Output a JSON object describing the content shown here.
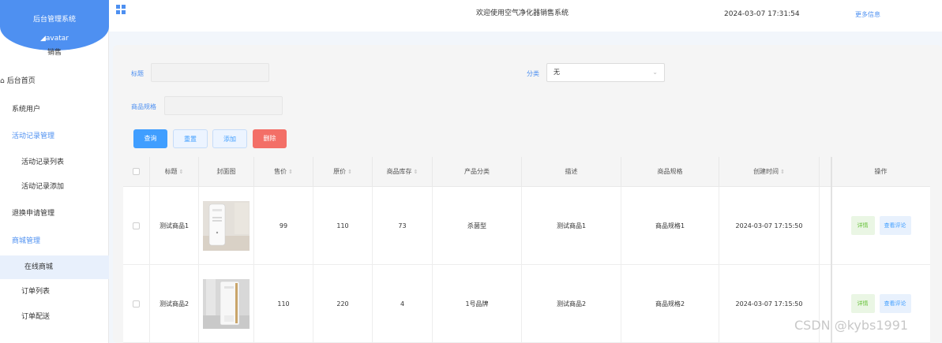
{
  "sidebar": {
    "system_name": "后台管理系统",
    "avatar_alt": "avatar",
    "role": "销售",
    "items": [
      {
        "label": "后台首页",
        "icon": "home-icon"
      },
      {
        "label": "系统用户"
      },
      {
        "label": "活动记录管理"
      },
      {
        "label": "活动记录列表"
      },
      {
        "label": "活动记录添加"
      },
      {
        "label": "退换申请管理"
      },
      {
        "label": "商城管理"
      },
      {
        "label": "在线商城"
      },
      {
        "label": "订单列表"
      },
      {
        "label": "订单配送"
      }
    ]
  },
  "header": {
    "title": "欢迎使用空气净化器销售系统",
    "datetime": "2024-03-07 17:31:54",
    "more_label": "更多信息"
  },
  "filters": {
    "title_label": "标题",
    "title_value": "",
    "category_label": "分类",
    "category_value": "无",
    "spec_label": "商品规格",
    "spec_value": ""
  },
  "actions": {
    "query": "查询",
    "reset": "重置",
    "add": "添加",
    "delete": "删除"
  },
  "table": {
    "columns": [
      "标题",
      "封面图",
      "售价",
      "原价",
      "商品库存",
      "产品分类",
      "描述",
      "商品规格",
      "创建时间",
      "操作"
    ],
    "rows": [
      {
        "title": "测试商品1",
        "price": "99",
        "orig_price": "110",
        "stock": "73",
        "category": "杀菌型",
        "desc": "测试商品1",
        "spec": "商品规格1",
        "created": "2024-03-07 17:15:50",
        "detail": "详情",
        "review": "查看评论"
      },
      {
        "title": "测试商品2",
        "price": "110",
        "orig_price": "220",
        "stock": "4",
        "category": "1号品牌",
        "desc": "测试商品2",
        "spec": "商品规格2",
        "created": "2024-03-07 17:15:50",
        "detail": "详情",
        "review": "查看评论"
      }
    ]
  },
  "watermark": "CSDN @kybs1991",
  "colors": {
    "primary": "#4e90f1",
    "danger": "#f36f67",
    "success": "#67c23a"
  }
}
